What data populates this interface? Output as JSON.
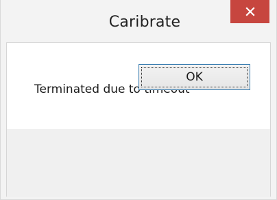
{
  "window": {
    "title": "Caribrate",
    "close_icon": "close-icon",
    "close_color": "#c7463f"
  },
  "dialog": {
    "message": "Terminated due to timeout",
    "ok_label": "OK"
  }
}
